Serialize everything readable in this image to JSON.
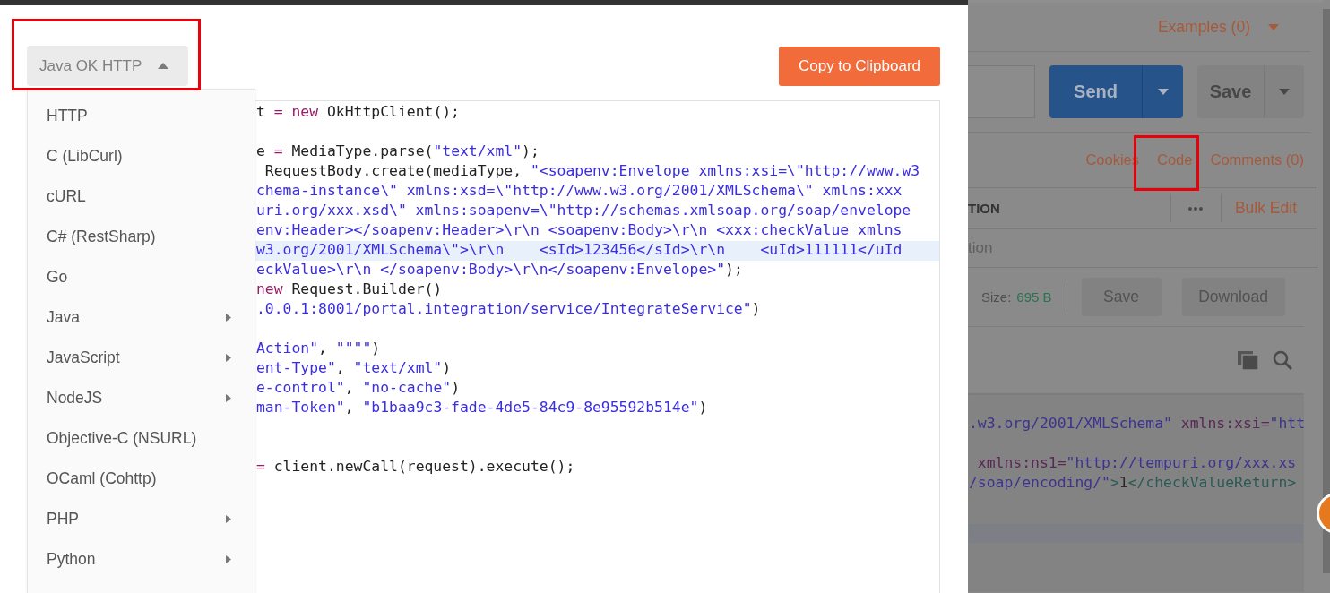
{
  "code_modal": {
    "language_dropdown": {
      "label": "Java OK HTTP",
      "expanded": true
    },
    "copy_button": "Copy to Clipboard",
    "language_menu": [
      {
        "label": "HTTP",
        "has_submenu": false
      },
      {
        "label": "C (LibCurl)",
        "has_submenu": false
      },
      {
        "label": "cURL",
        "has_submenu": false
      },
      {
        "label": "C# (RestSharp)",
        "has_submenu": false
      },
      {
        "label": "Go",
        "has_submenu": false
      },
      {
        "label": "Java",
        "has_submenu": true
      },
      {
        "label": "JavaScript",
        "has_submenu": true
      },
      {
        "label": "NodeJS",
        "has_submenu": true
      },
      {
        "label": "Objective-C (NSURL)",
        "has_submenu": false
      },
      {
        "label": "OCaml (Cohttp)",
        "has_submenu": false
      },
      {
        "label": "PHP",
        "has_submenu": true
      },
      {
        "label": "Python",
        "has_submenu": true
      }
    ],
    "code_lines": [
      {
        "kind": "code",
        "highlighted": false,
        "segments": [
          {
            "kind": "plain",
            "text": "t "
          },
          {
            "kind": "keyword",
            "text": "= new"
          },
          {
            "kind": "plain",
            "text": " OkHttpClient();"
          }
        ]
      },
      {
        "kind": "blank"
      },
      {
        "kind": "code",
        "highlighted": false,
        "segments": [
          {
            "kind": "plain",
            "text": "e "
          },
          {
            "kind": "keyword",
            "text": "="
          },
          {
            "kind": "plain",
            "text": " MediaType.parse("
          },
          {
            "kind": "string",
            "text": "\"text/xml\""
          },
          {
            "kind": "plain",
            "text": ");"
          }
        ]
      },
      {
        "kind": "code",
        "highlighted": false,
        "segments": [
          {
            "kind": "plain",
            "text": " RequestBody.create(mediaType, "
          },
          {
            "kind": "string",
            "text": "\"<soapenv:Envelope xmlns:xsi=\\\"http://www.w3"
          }
        ]
      },
      {
        "kind": "code",
        "highlighted": false,
        "segments": [
          {
            "kind": "string",
            "text": "chema-instance\\\" xmlns:xsd=\\\"http://www.w3.org/2001/XMLSchema\\\" xmlns:xxx"
          }
        ]
      },
      {
        "kind": "code",
        "highlighted": false,
        "segments": [
          {
            "kind": "string",
            "text": "uri.org/xxx.xsd\\\" xmlns:soapenv=\\\"http://schemas.xmlsoap.org/soap/envelope"
          }
        ]
      },
      {
        "kind": "code",
        "highlighted": false,
        "segments": [
          {
            "kind": "string",
            "text": "env:Header></soapenv:Header>\\r\\n <soapenv:Body>\\r\\n <xxx:checkValue xmlns"
          }
        ]
      },
      {
        "kind": "code",
        "highlighted": true,
        "segments": [
          {
            "kind": "string",
            "text": "w3.org/2001/XMLSchema\\\">\\r\\n    <sId>123456</sId>\\r\\n    <uId>111111</uId"
          }
        ]
      },
      {
        "kind": "code",
        "highlighted": false,
        "segments": [
          {
            "kind": "string",
            "text": "eckValue>\\r\\n </soapenv:Body>\\r\\n</soapenv:Envelope>\""
          },
          {
            "kind": "plain",
            "text": ");"
          }
        ]
      },
      {
        "kind": "code",
        "highlighted": false,
        "segments": [
          {
            "kind": "keyword",
            "text": "new"
          },
          {
            "kind": "plain",
            "text": " Request.Builder()"
          }
        ]
      },
      {
        "kind": "code",
        "highlighted": false,
        "segments": [
          {
            "kind": "string",
            "text": ".0.0.1:8001/portal.integration/service/IntegrateService\""
          },
          {
            "kind": "plain",
            "text": ")"
          }
        ]
      },
      {
        "kind": "blank"
      },
      {
        "kind": "code",
        "highlighted": false,
        "segments": [
          {
            "kind": "string",
            "text": "Action\""
          },
          {
            "kind": "plain",
            "text": ", "
          },
          {
            "kind": "string",
            "text": "\"\"\"\""
          },
          {
            "kind": "plain",
            "text": ")"
          }
        ]
      },
      {
        "kind": "code",
        "highlighted": false,
        "segments": [
          {
            "kind": "string",
            "text": "ent-Type\""
          },
          {
            "kind": "plain",
            "text": ", "
          },
          {
            "kind": "string",
            "text": "\"text/xml\""
          },
          {
            "kind": "plain",
            "text": ")"
          }
        ]
      },
      {
        "kind": "code",
        "highlighted": false,
        "segments": [
          {
            "kind": "string",
            "text": "e-control\""
          },
          {
            "kind": "plain",
            "text": ", "
          },
          {
            "kind": "string",
            "text": "\"no-cache\""
          },
          {
            "kind": "plain",
            "text": ")"
          }
        ]
      },
      {
        "kind": "code",
        "highlighted": false,
        "segments": [
          {
            "kind": "string",
            "text": "man-Token\""
          },
          {
            "kind": "plain",
            "text": ", "
          },
          {
            "kind": "string",
            "text": "\"b1baa9c3-fade-4de5-84c9-8e95592b514e\""
          },
          {
            "kind": "plain",
            "text": ")"
          }
        ]
      },
      {
        "kind": "blank"
      },
      {
        "kind": "blank"
      },
      {
        "kind": "code",
        "highlighted": false,
        "segments": [
          {
            "kind": "keyword",
            "text": "="
          },
          {
            "kind": "plain",
            "text": " client.newCall(request).execute();"
          }
        ]
      }
    ]
  },
  "background": {
    "examples_menu": "Examples (0)",
    "send_button": "Send",
    "save_button": "Save",
    "links": [
      "Cookies",
      "Code",
      "Comments (0)"
    ],
    "params_table": {
      "header": "TION",
      "more": "•••",
      "bulk_edit": "Bulk Edit",
      "placeholder": "tion"
    },
    "response_bar": {
      "size_label": "Size:",
      "size_value": "695 B",
      "save_button": "Save",
      "download_button": "Download"
    },
    "response_lines": [
      {
        "segments": [
          {
            "kind": "string",
            "text": ".w3.org/2001/XMLSchema\""
          },
          {
            "kind": "attr",
            "text": " xmlns:xsi="
          },
          {
            "kind": "string",
            "text": "\"htt"
          }
        ]
      },
      {
        "segments": [
          {
            "kind": "attr",
            "text": " xmlns:ns1="
          },
          {
            "kind": "string",
            "text": "\"http://tempuri.org/xxx.xs"
          }
        ]
      },
      {
        "segments": [
          {
            "kind": "string",
            "text": "/soap/encoding/\""
          },
          {
            "kind": "tag",
            "text": ">"
          },
          {
            "kind": "plain",
            "text": "1"
          },
          {
            "kind": "tag",
            "text": "</checkValueReturn>"
          }
        ]
      }
    ]
  }
}
